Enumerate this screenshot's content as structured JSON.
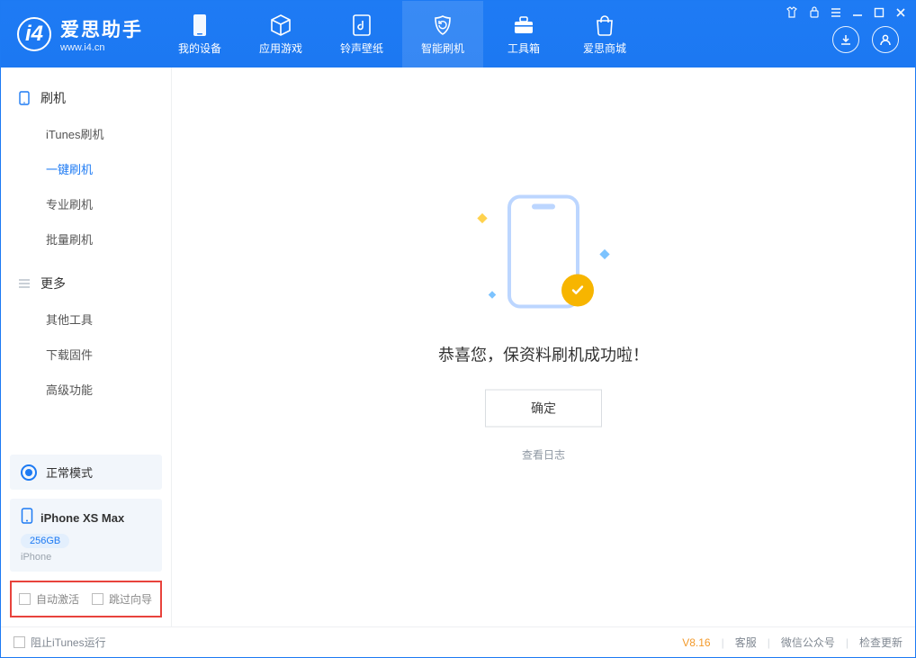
{
  "brand": {
    "name": "爱思助手",
    "url": "www.i4.cn"
  },
  "nav": {
    "tabs": [
      {
        "label": "我的设备"
      },
      {
        "label": "应用游戏"
      },
      {
        "label": "铃声壁纸"
      },
      {
        "label": "智能刷机"
      },
      {
        "label": "工具箱"
      },
      {
        "label": "爱思商城"
      }
    ],
    "activeIndex": 3
  },
  "sidebar": {
    "groups": [
      {
        "title": "刷机",
        "items": [
          "iTunes刷机",
          "一键刷机",
          "专业刷机",
          "批量刷机"
        ],
        "activeIndex": 1
      },
      {
        "title": "更多",
        "items": [
          "其他工具",
          "下载固件",
          "高级功能"
        ],
        "activeIndex": -1
      }
    ],
    "mode_label": "正常模式",
    "device": {
      "name": "iPhone XS Max",
      "capacity": "256GB",
      "subtype": "iPhone"
    },
    "checks": {
      "auto_activate": "自动激活",
      "skip_guide": "跳过向导"
    }
  },
  "main": {
    "success_message": "恭喜您，保资料刷机成功啦！",
    "ok_button": "确定",
    "view_log": "查看日志"
  },
  "status": {
    "block_itunes": "阻止iTunes运行",
    "version": "V8.16",
    "links": [
      "客服",
      "微信公众号",
      "检查更新"
    ]
  }
}
